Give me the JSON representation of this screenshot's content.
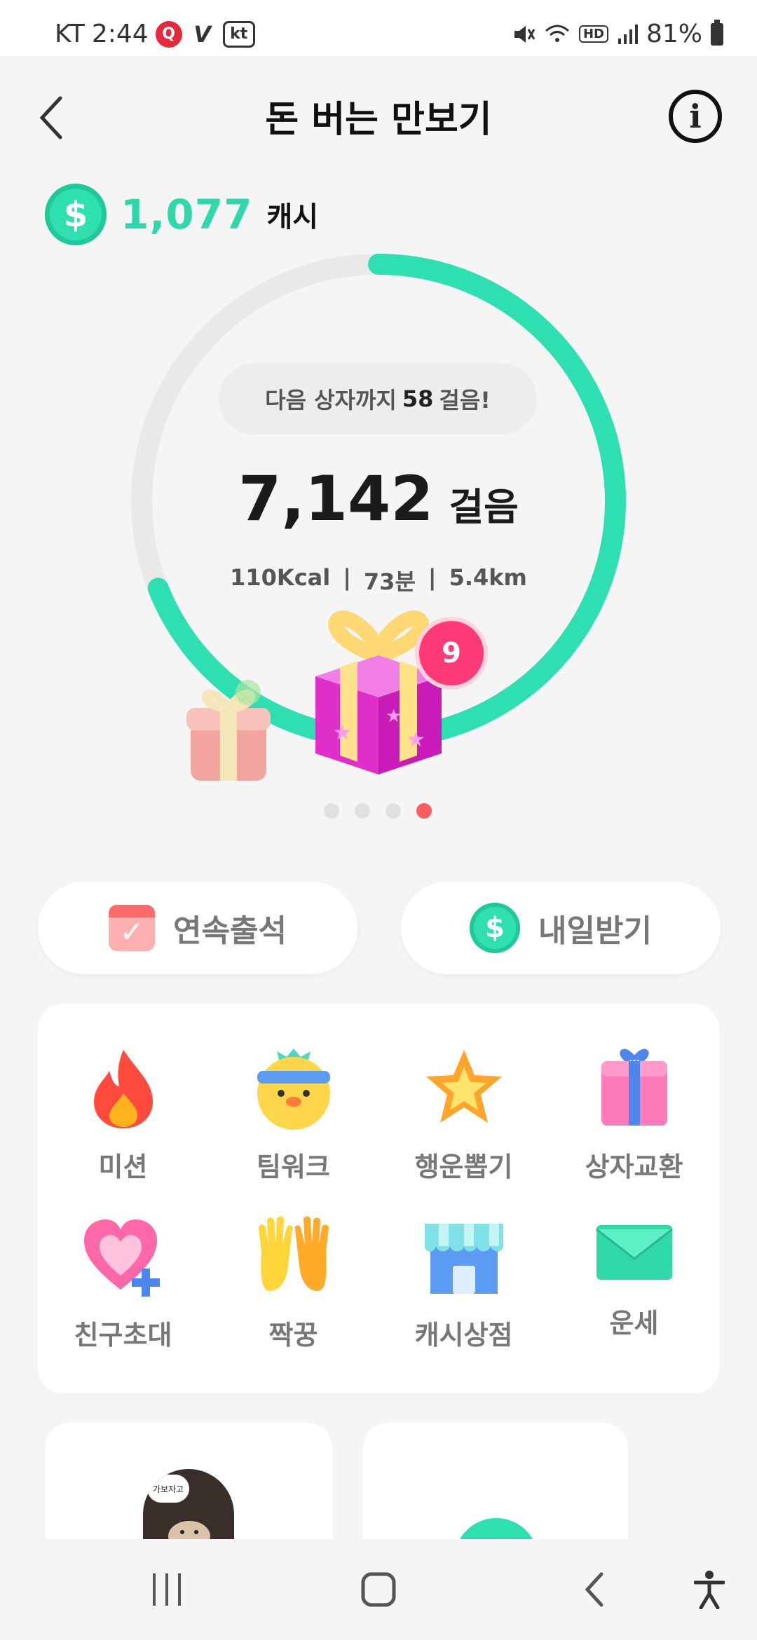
{
  "status_bar": {
    "carrier": "KT",
    "time": "2:44",
    "battery": "81%",
    "hd_label": "HD"
  },
  "header": {
    "title": "돈 버는 만보기"
  },
  "cash": {
    "symbol": "$",
    "amount": "1,077",
    "unit": "캐시"
  },
  "progress": {
    "fraction": 0.69,
    "next_box_prefix": "다음 상자까지",
    "next_box_steps": "58",
    "next_box_suffix": "걸음!",
    "steps": "7,142",
    "steps_unit": "걸음",
    "kcal": "110Kcal",
    "minutes": "73분",
    "distance": "5.4km",
    "separator": "|",
    "gift_count": "9",
    "page_dots": 4,
    "active_dot": 3,
    "accent_color": "#2ee0b1",
    "track_color": "#e9e9e9"
  },
  "actions": {
    "attendance_label": "연속출석",
    "tomorrow_label": "내일받기",
    "coin_symbol": "$"
  },
  "menu": [
    {
      "label": "미션",
      "icon": "fire-icon"
    },
    {
      "label": "팀워크",
      "icon": "chick-icon"
    },
    {
      "label": "행운뽑기",
      "icon": "star-icon"
    },
    {
      "label": "상자교환",
      "icon": "gift-box-icon"
    },
    {
      "label": "친구초대",
      "icon": "heart-plus-icon"
    },
    {
      "label": "짝꿍",
      "icon": "high-five-icon"
    },
    {
      "label": "캐시상점",
      "icon": "store-icon"
    },
    {
      "label": "운세",
      "icon": "envelope-icon"
    }
  ],
  "bottom_cards": {
    "hamster_bubble": "가보자고"
  }
}
